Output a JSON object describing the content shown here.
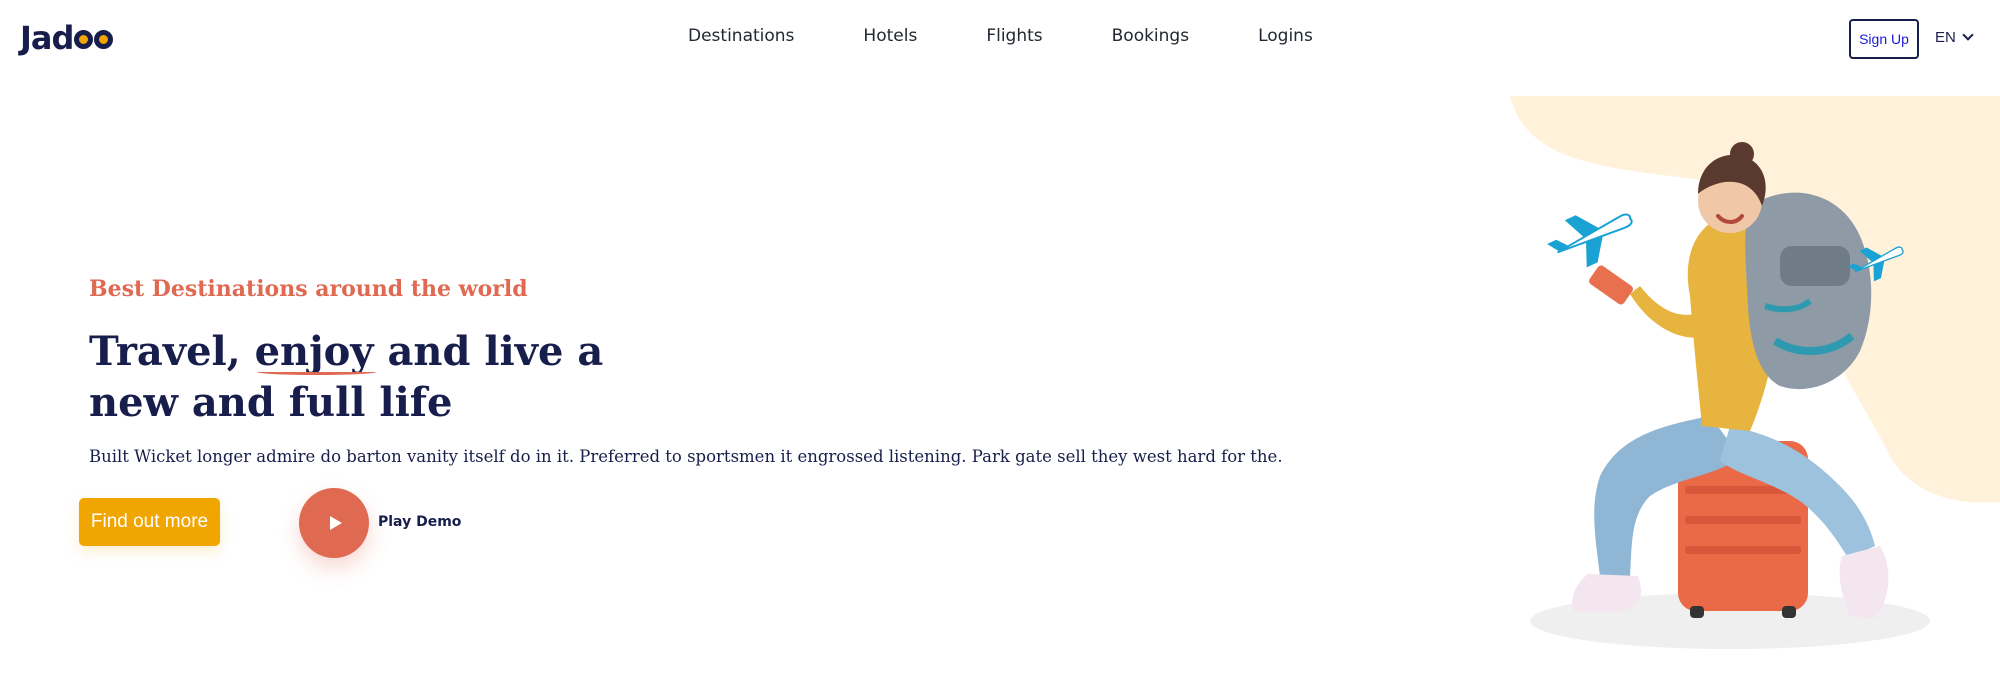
{
  "brand": {
    "name": "Jadoo"
  },
  "nav": {
    "items": [
      "Destinations",
      "Hotels",
      "Flights",
      "Bookings",
      "Logins"
    ]
  },
  "header": {
    "signup_label": "Sign Up",
    "language": "EN"
  },
  "hero": {
    "eyebrow": "Best Destinations around the world",
    "headline_part1": "Travel, ",
    "headline_highlight": "enjoy",
    "headline_part2": " and live a new and full life",
    "description": "Built Wicket longer admire do barton vanity itself do in it. Preferred to sportsmen it engrossed listening. Park gate sell they west hard for the.",
    "cta_label": "Find out more",
    "play_label": "Play Demo"
  },
  "colors": {
    "primary_orange": "#F1A501",
    "accent_red": "#DF6951",
    "navy": "#181E4B",
    "cream": "#FFF1DA",
    "plane_blue": "#1AA2D4"
  },
  "icons": {
    "play": "play-icon",
    "chevron": "chevron-down-icon",
    "planes": "airplane-icon"
  }
}
